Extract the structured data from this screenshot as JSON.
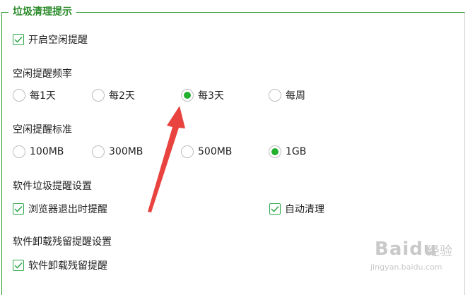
{
  "group_title": "垃圾清理提示",
  "idle_reminder": {
    "label": "开启空闲提醒",
    "checked": true
  },
  "frequency": {
    "title": "空闲提醒频率",
    "options": [
      "每1天",
      "每2天",
      "每3天",
      "每周"
    ],
    "selected": "每3天"
  },
  "standard": {
    "title": "空闲提醒标准",
    "options": [
      "100MB",
      "300MB",
      "500MB",
      "1GB"
    ],
    "selected": "1GB"
  },
  "software_trash": {
    "title": "软件垃圾提醒设置",
    "items": [
      {
        "label": "浏览器退出时提醒",
        "checked": true
      },
      {
        "label": "自动清理",
        "checked": true
      }
    ]
  },
  "uninstall_residue": {
    "title": "软件卸载残留提醒设置",
    "items": [
      {
        "label": "软件卸载残留提醒",
        "checked": true
      }
    ]
  },
  "watermark": {
    "brand": "Baidu",
    "cn": "经验",
    "url": "jingyan.baidu.com"
  },
  "colors": {
    "accent": "#2a9a2a",
    "radio_selected": "#22b02e",
    "arrow": "#e8433f"
  }
}
